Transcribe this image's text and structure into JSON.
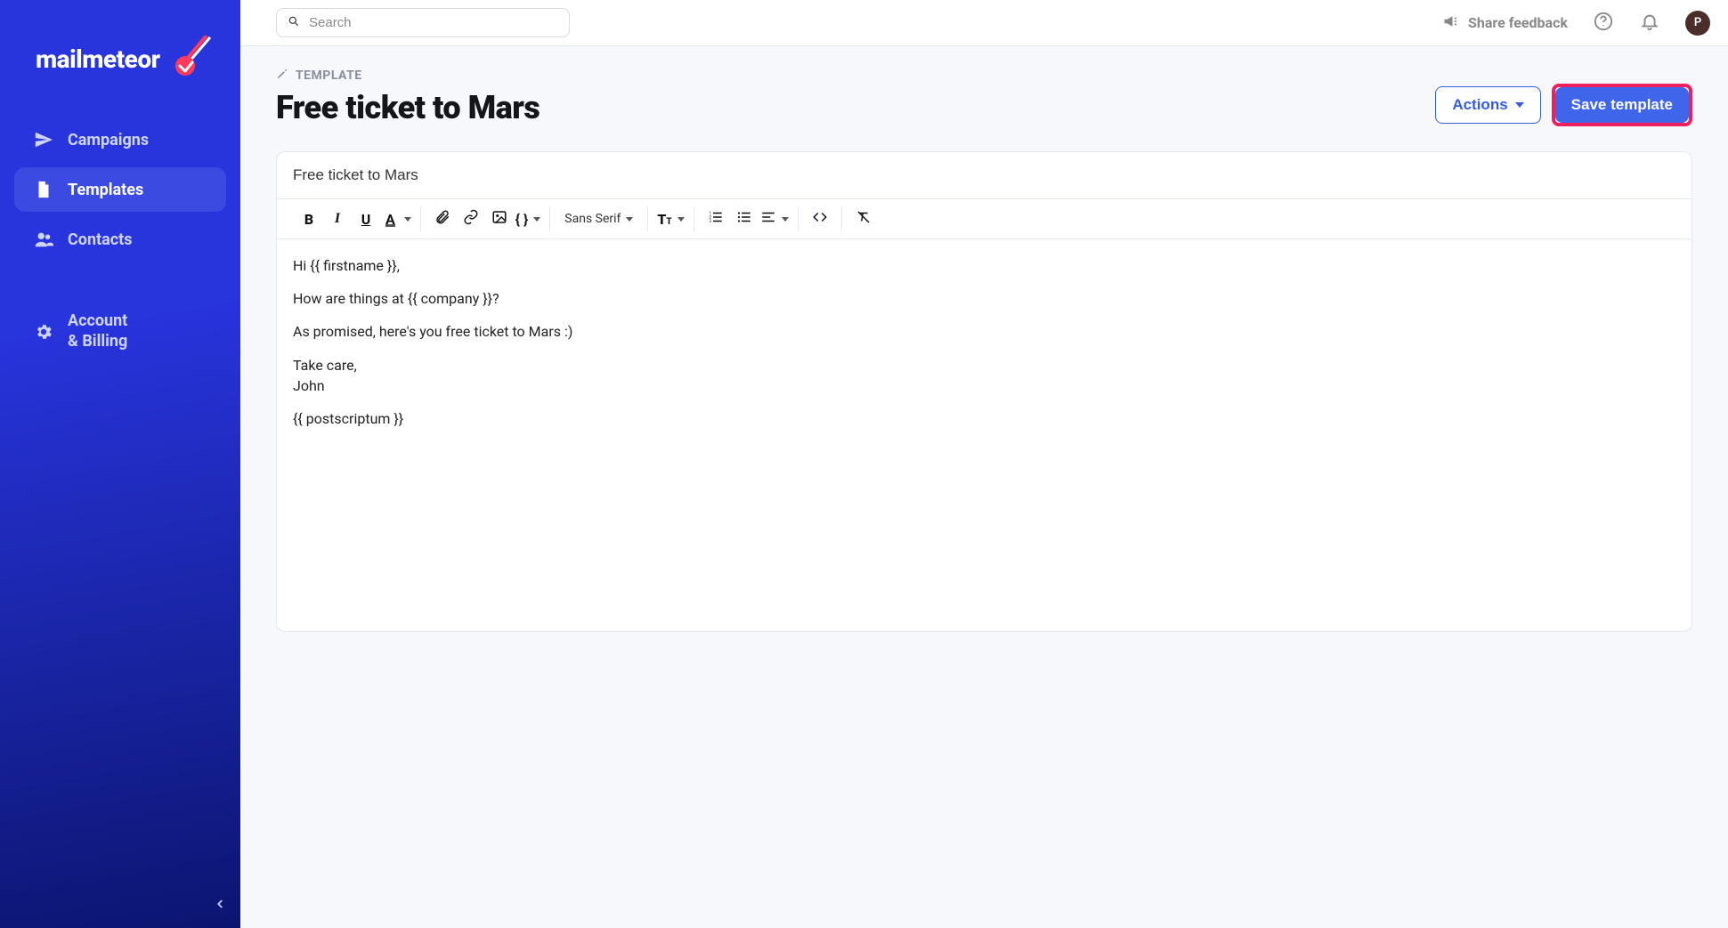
{
  "brand": {
    "name": "mailmeteor"
  },
  "sidebar": {
    "items": [
      {
        "label": "Campaigns"
      },
      {
        "label": "Templates"
      },
      {
        "label": "Contacts"
      },
      {
        "label_line1": "Account",
        "label_line2": "& Billing"
      }
    ]
  },
  "topbar": {
    "search_placeholder": "Search",
    "share_feedback": "Share feedback",
    "avatar_initial": "P"
  },
  "page": {
    "breadcrumb_label": "TEMPLATE",
    "title": "Free ticket to Mars",
    "actions_label": "Actions",
    "save_label": "Save template"
  },
  "editor": {
    "subject": "Free ticket to Mars",
    "font_family_label": "Sans Serif",
    "body": {
      "line1": "Hi {{ firstname }},",
      "line2": "How are things at {{ company }}?",
      "line3": "As promised, here's you free ticket to Mars :)",
      "line4a": "Take care,",
      "line4b": "John",
      "line5": "{{ postscriptum }}"
    }
  }
}
